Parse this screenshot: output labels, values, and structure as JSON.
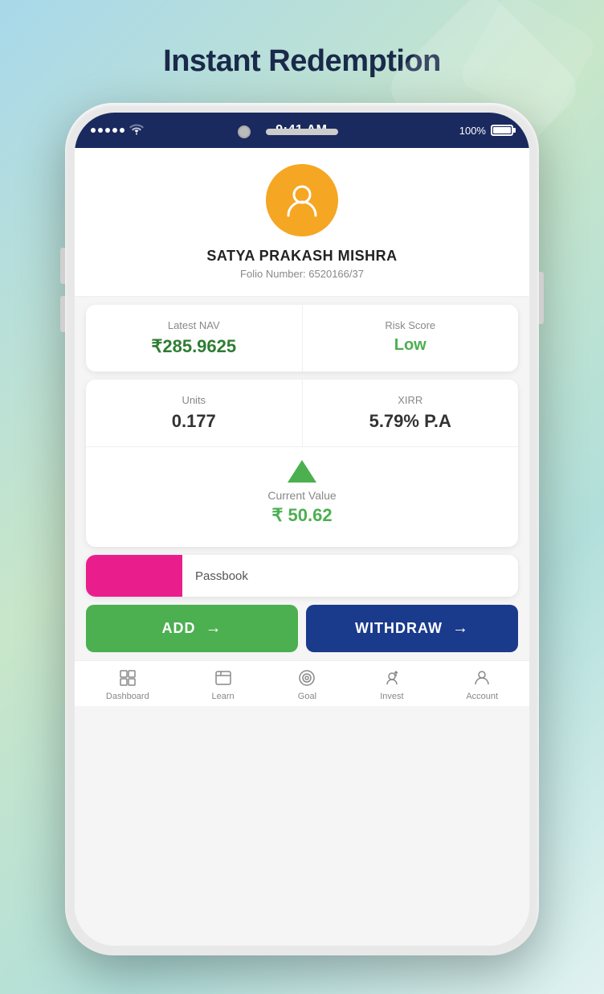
{
  "page": {
    "title": "Instant Redemption"
  },
  "statusBar": {
    "time": "9:41 AM",
    "battery": "100%"
  },
  "profile": {
    "name": "SATYA PRAKASH MISHRA",
    "folio": "Folio Number: 6520166/37",
    "avatarAlt": "User Avatar"
  },
  "stats": {
    "navLabel": "Latest NAV",
    "navValue": "₹285.9625",
    "riskLabel": "Risk Score",
    "riskValue": "Low"
  },
  "investment": {
    "unitsLabel": "Units",
    "unitsValue": "0.177",
    "xirrLabel": "XIRR",
    "xirrValue": "5.79% P.A",
    "currentValueLabel": "Current Value",
    "currentValueAmount": "₹ 50.62"
  },
  "passbook": {
    "label": "Passbook"
  },
  "buttons": {
    "add": "ADD",
    "withdraw": "WITHDRAW"
  },
  "bottomNav": {
    "items": [
      {
        "label": "Dashboard",
        "icon": "dashboard-icon"
      },
      {
        "label": "Learn",
        "icon": "learn-icon"
      },
      {
        "label": "Goal",
        "icon": "goal-icon"
      },
      {
        "label": "Invest",
        "icon": "invest-icon"
      },
      {
        "label": "Account",
        "icon": "account-icon"
      }
    ]
  }
}
